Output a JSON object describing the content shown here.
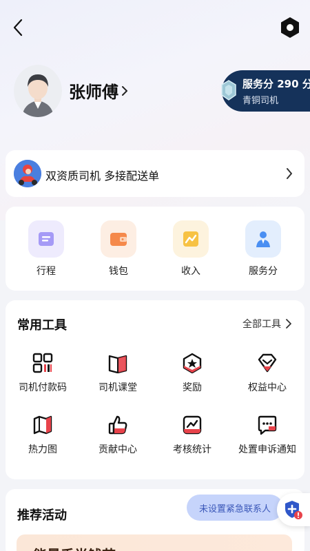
{
  "profile": {
    "name": "张师傅",
    "score_title": "服务分 290 分",
    "score_level": "青铜司机"
  },
  "qualification": {
    "text": "双资质司机 多接配送单"
  },
  "quick_actions": [
    {
      "label": "行程",
      "icon": "trip-icon",
      "color": "#9f95f3"
    },
    {
      "label": "钱包",
      "icon": "wallet-icon",
      "color": "#f5894b"
    },
    {
      "label": "收入",
      "icon": "income-icon",
      "color": "#f7c244"
    },
    {
      "label": "服务分",
      "icon": "service-score-icon",
      "color": "#4a8ff2"
    }
  ],
  "tools": {
    "title": "常用工具",
    "all_label": "全部工具",
    "items": [
      {
        "label": "司机付款码",
        "icon": "qr-code-icon"
      },
      {
        "label": "司机课堂",
        "icon": "book-icon"
      },
      {
        "label": "奖励",
        "icon": "reward-icon"
      },
      {
        "label": "权益中心",
        "icon": "benefits-icon"
      },
      {
        "label": "热力图",
        "icon": "heatmap-icon"
      },
      {
        "label": "贡献中心",
        "icon": "thumbs-up-icon"
      },
      {
        "label": "考核统计",
        "icon": "stats-icon"
      },
      {
        "label": "处置申诉通知",
        "icon": "message-icon"
      }
    ]
  },
  "recommend": {
    "title": "推荐活动",
    "banner_text": "能量手半钱节"
  },
  "emergency": {
    "label": "未设置紧急联系人"
  },
  "colors": {
    "accent_dark": "#15325a",
    "tool_red": "#e8434b"
  }
}
